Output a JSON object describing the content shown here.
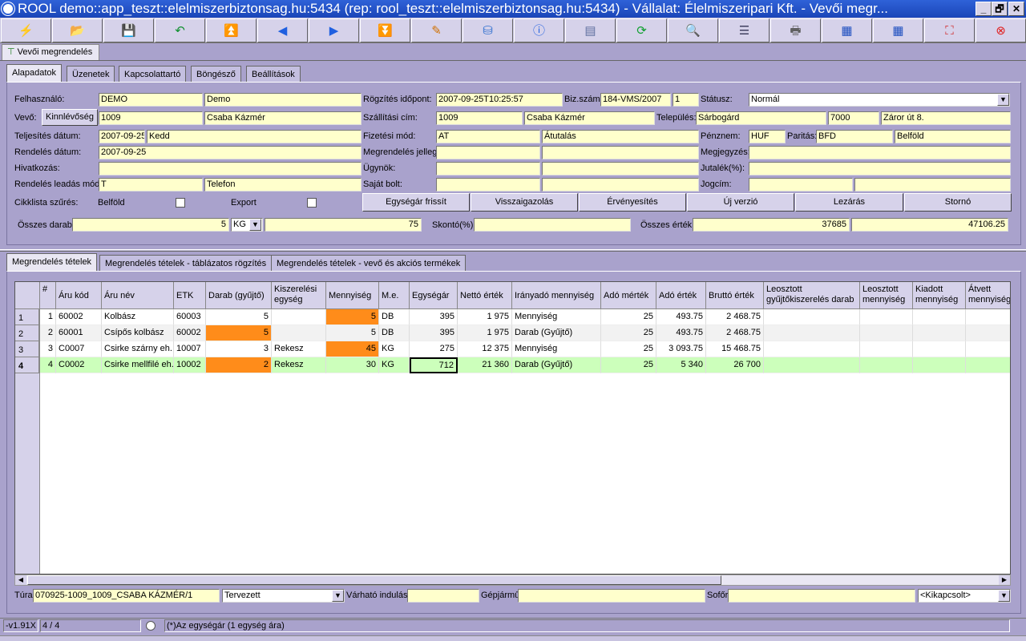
{
  "window": {
    "title": "ROOL demo::app_teszt::elelmiszerbiztonsag.hu:5434 (rep: rool_teszt::elelmiszerbiztonsag.hu:5434) - Vállalat: Élelmiszeripari Kft. - Vevői megr...",
    "min": "_",
    "max": "🗗",
    "close": "✕"
  },
  "doc_tab": "Vevői megrendelés",
  "top_tabs": [
    "Alapadatok",
    "Üzenetek",
    "Kapcsolattartó",
    "Böngésző",
    "Beállítások"
  ],
  "form": {
    "felhasznalo_label": "Felhasználó:",
    "felhasznalo_code": "DEMO",
    "felhasznalo_name": "Demo",
    "vevo_label": "Vevő:",
    "kinnlevoseg_button": "Kinnlévőség",
    "vevo_code": "1009",
    "vevo_name": "Csaba Kázmér",
    "teljesites_label": "Teljesítés dátum:",
    "teljesites_date": "2007-09-25",
    "teljesites_day": "Kedd",
    "rendeles_datum_label": "Rendelés dátum:",
    "rendeles_datum": "2007-09-25",
    "hivatkozas_label": "Hivatkozás:",
    "hivatkozas": "",
    "leadas_label": "Rendelés leadás mód:",
    "leadas_code": "T",
    "leadas_name": "Telefon",
    "cikklista_label": "Cikklista szűrés:",
    "belfold_label": "Belföld",
    "export_label": "Export",
    "rogzites_label": "Rögzítés időpont:",
    "rogzites": "2007-09-25T10:25:57",
    "bizszam_label": "Biz.szám:",
    "bizszam": "184-VMS/2007",
    "bizszam_ver": "1",
    "statusz_label": "Státusz:",
    "statusz": "Normál",
    "szallitasi_label": "Szállítási cím:",
    "szallitasi_code": "1009",
    "szallitasi_name": "Csaba Kázmér",
    "telepules_label": "Település:",
    "telepules": "Sárbogárd",
    "irsz": "7000",
    "utca": "Záror út 8.",
    "fizetesi_label": "Fizetési mód:",
    "fizetesi_code": "AT",
    "fizetesi_name": "Átutalás",
    "penznem_label": "Pénznem:",
    "penznem": "HUF",
    "paritas_label": "Paritás:",
    "paritas_code": "BFD",
    "paritas_name": "Belföld",
    "jelleg_label": "Megrendelés jelleg:",
    "megjegyzes_label": "Megjegyzés:",
    "ugynok_label": "Ügynök:",
    "jutalek_label": "Jutalék(%):",
    "sajat_bolt_label": "Saját bolt:",
    "jogcim_label": "Jogcím:",
    "osszes_darab_label": "Összes darab:",
    "osszes_darab": "5",
    "unit": "KG",
    "osszes_mennyiseg": "75",
    "skonto_label": "Skontó(%):",
    "skonto": "",
    "osszes_ertek_label": "Összes érték:",
    "netto_ossz": "37685",
    "brutto_ossz": "47106.25"
  },
  "action_buttons": [
    "Egységár frissít",
    "Visszaigazolás",
    "Érvényesítés",
    "Új verzió",
    "Lezárás",
    "Stornó"
  ],
  "bottom_tabs": [
    "Megrendelés tételek",
    "Megrendelés tételek - táblázatos rögzítés",
    "Megrendelés tételek - vevő és akciós termékek"
  ],
  "grid": {
    "headers": [
      "#",
      "Áru kód",
      "Áru név",
      "ETK",
      "Darab (gyűjtő)",
      "Kiszerelési egység",
      "Mennyiség",
      "M.e.",
      "Egységár",
      "Nettó érték",
      "Irányadó mennyiség",
      "Adó mérték",
      "Adó érték",
      "Bruttó érték",
      "Leosztott gyűjtőkiszerelés darab",
      "Leosztott mennyiség",
      "Kiadott mennyiség",
      "Átvett mennyiség"
    ],
    "rows": [
      {
        "rh": "1",
        "n": "1",
        "kod": "60002",
        "nev": "Kolbász",
        "etk": "60003",
        "darab": "5",
        "kisz": "",
        "menny": "5",
        "me": "DB",
        "ar": "395",
        "netto": "1 975",
        "irany": "Mennyiség",
        "ado_m": "25",
        "ado_e": "493.75",
        "brutto": "2 468.75"
      },
      {
        "rh": "2",
        "n": "2",
        "kod": "60001",
        "nev": "Csípős kolbász",
        "etk": "60002",
        "darab": "5",
        "kisz": "",
        "menny": "5",
        "me": "DB",
        "ar": "395",
        "netto": "1 975",
        "irany": "Darab (Gyűjtő)",
        "ado_m": "25",
        "ado_e": "493.75",
        "brutto": "2 468.75"
      },
      {
        "rh": "3",
        "n": "3",
        "kod": "C0007",
        "nev": "Csirke szárny eh.",
        "etk": "10007",
        "darab": "3",
        "kisz": "Rekesz",
        "menny": "45",
        "me": "KG",
        "ar": "275",
        "netto": "12 375",
        "irany": "Mennyiség",
        "ado_m": "25",
        "ado_e": "3 093.75",
        "brutto": "15 468.75"
      },
      {
        "rh": "4",
        "n": "4",
        "kod": "C0002",
        "nev": "Csirke mellfilé eh.",
        "etk": "10002",
        "darab": "2",
        "kisz": "Rekesz",
        "menny": "30",
        "me": "KG",
        "ar": "712",
        "netto": "21 360",
        "irany": "Darab (Gyűjtő)",
        "ado_m": "25",
        "ado_e": "5 340",
        "brutto": "26 700"
      }
    ]
  },
  "bottom": {
    "tura_label": "Túra",
    "tura": "070925-1009_1009_CSABA KÁZMÉR/1",
    "tervezett": "Tervezett",
    "varhato_label": "Várható indulás",
    "gepjarmu_label": "Gépjármű",
    "sofor_label": "Sofőr",
    "kikapcsolt": "<Kikapcsolt>"
  },
  "status": {
    "version": "-v1.91X",
    "records": "4 / 4",
    "note": "(*)Az egységár (1 egység ára)"
  },
  "colors": {
    "accent_orange": "#ff8c1a",
    "selected_row": "#ccffbb",
    "field_bg": "#ffffcc"
  },
  "toolbar_icons": [
    "lightning-icon",
    "open-icon",
    "save-icon",
    "undo-icon",
    "first-icon",
    "prev-icon",
    "next-icon",
    "last-icon",
    "edit-icon",
    "database-icon",
    "info-icon",
    "layout-icon",
    "refresh-icon",
    "search-icon",
    "filter-icon",
    "print-icon",
    "table-export-icon",
    "table-import-icon",
    "fit-icon",
    "close-icon"
  ]
}
